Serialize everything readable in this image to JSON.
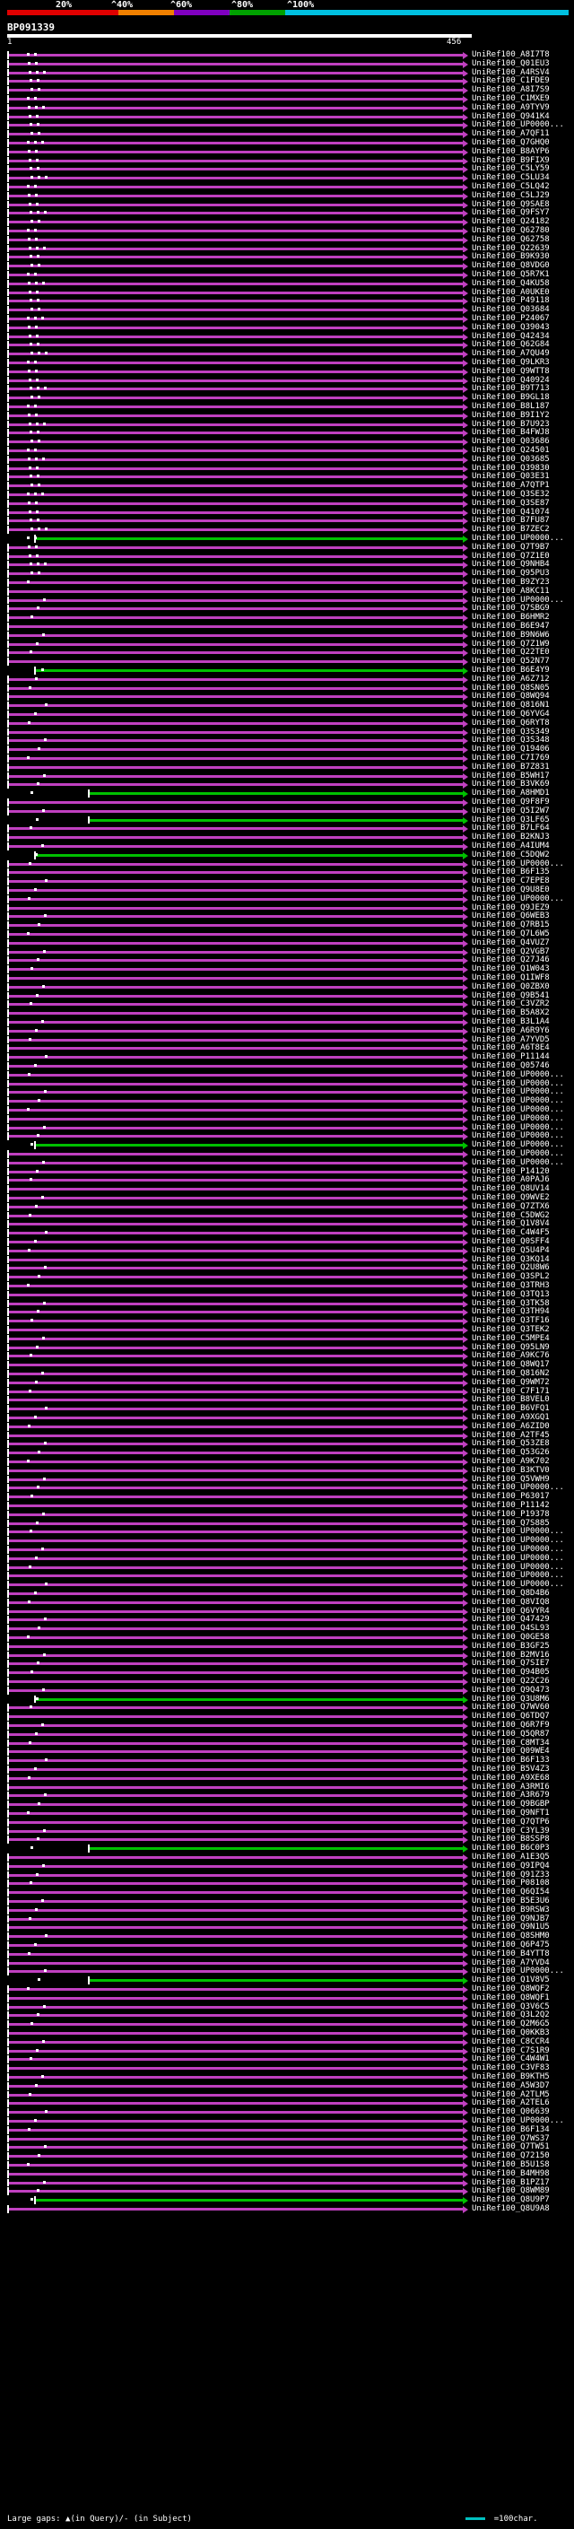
{
  "scale": {
    "labels": [
      "20%",
      "^40%",
      "^60%",
      "^80%",
      "^100%"
    ],
    "colors": [
      "#e00000",
      "#f08000",
      "#8000c0",
      "#00a000",
      "#00c0e0"
    ]
  },
  "query": {
    "id": "BP091339",
    "start": "1",
    "end": "456"
  },
  "colors": {
    "hit_line": "#c040c0",
    "green": "#00c000",
    "gap_marker": "#ff80ff",
    "legend_line": "#00c0c0"
  },
  "hits": [
    "UniRef100_A8I7T8",
    "UniRef100_Q01EU3",
    "UniRef100_A4RSV4",
    "UniRef100_C1FDE9",
    "UniRef100_A8I7S9",
    "UniRef100_C1MXE9",
    "UniRef100_A9TYV9",
    "UniRef100_Q941K4",
    "UniRef100_UP0000...",
    "UniRef100_A7QF11",
    "UniRef100_Q7GHQ0",
    "UniRef100_B8AYP6",
    "UniRef100_B9FIX9",
    "UniRef100_C5LY59",
    "UniRef100_C5LU34",
    "UniRef100_C5LQ42",
    "UniRef100_C5LJ29",
    "UniRef100_Q9SAE8",
    "UniRef100_Q9FSY7",
    "UniRef100_Q24182",
    "UniRef100_Q62780",
    "UniRef100_Q62758",
    "UniRef100_Q22639",
    "UniRef100_B9K930",
    "UniRef100_Q8VDG0",
    "UniRef100_Q5R7K1",
    "UniRef100_Q4KU58",
    "UniRef100_A0UKE0",
    "UniRef100_P49118",
    "UniRef100_Q03684",
    "UniRef100_P24067",
    "UniRef100_Q39043",
    "UniRef100_Q42434",
    "UniRef100_Q62G84",
    "UniRef100_A7QU49",
    "UniRef100_Q9LKR3",
    "UniRef100_Q9WTT8",
    "UniRef100_Q40924",
    "UniRef100_B9T713",
    "UniRef100_B9GL18",
    "UniRef100_B8L187",
    "UniRef100_B9I1Y2",
    "UniRef100_B7U923",
    "UniRef100_B4FWJ8",
    "UniRef100_Q03686",
    "UniRef100_Q24501",
    "UniRef100_Q03685",
    "UniRef100_Q39830",
    "UniRef100_Q03E31",
    "UniRef100_A7QTP1",
    "UniRef100_Q3SE32",
    "UniRef100_Q3SE87",
    "UniRef100_Q41074",
    "UniRef100_B7FU87",
    "UniRef100_B7ZEC2",
    "UniRef100_UP0000...",
    "UniRef100_Q7T9B7",
    "UniRef100_Q7Z1E0",
    "UniRef100_Q9NHB4",
    "UniRef100_Q95PU3",
    "UniRef100_B9ZY23",
    "UniRef100_A8KC11",
    "UniRef100_UP0000...",
    "UniRef100_Q7SBG9",
    "UniRef100_B6HMR2",
    "UniRef100_B6E947",
    "UniRef100_B9N6W6",
    "UniRef100_Q7Z1W9",
    "UniRef100_Q22TE0",
    "UniRef100_Q52N77",
    "UniRef100_B6E4Y9",
    "UniRef100_A6Z712",
    "UniRef100_Q8SN05",
    "UniRef100_Q8WQ94",
    "UniRef100_Q816N1",
    "UniRef100_Q6YVG4",
    "UniRef100_Q6RYT8",
    "UniRef100_Q3S349",
    "UniRef100_Q3S348",
    "UniRef100_Q19406",
    "UniRef100_C7I769",
    "UniRef100_B7Z831",
    "UniRef100_B5WH17",
    "UniRef100_B3VK69",
    "UniRef100_A8HMD1",
    "UniRef100_Q9F8F9",
    "UniRef100_Q5I2W7",
    "UniRef100_Q3LF65",
    "UniRef100_B7LF64",
    "UniRef100_B2KNJ3",
    "UniRef100_A4IUM4",
    "UniRef100_C5DQW2",
    "UniRef100_UP0000...",
    "UniRef100_B6F135",
    "UniRef100_C7EPE8",
    "UniRef100_Q9U8E0",
    "UniRef100_UP0000...",
    "UniRef100_Q9JEZ9",
    "UniRef100_Q6WEB3",
    "UniRef100_Q7RB15",
    "UniRef100_Q7L6W5",
    "UniRef100_Q4VUZ7",
    "UniRef100_Q2VGB7",
    "UniRef100_Q27J46",
    "UniRef100_Q1W043",
    "UniRef100_Q1IWF8",
    "UniRef100_Q0ZBX0",
    "UniRef100_Q9B541",
    "UniRef100_C3VZR2",
    "UniRef100_B5A8X2",
    "UniRef100_B3L1A4",
    "UniRef100_A6R9Y6",
    "UniRef100_A7YVD5",
    "UniRef100_A6T8E4",
    "UniRef100_P11144",
    "UniRef100_Q05746",
    "UniRef100_UP0000...",
    "UniRef100_UP0000...",
    "UniRef100_UP0000...",
    "UniRef100_UP0000...",
    "UniRef100_UP0000...",
    "UniRef100_UP0000...",
    "UniRef100_UP0000...",
    "UniRef100_UP0000...",
    "UniRef100_UP0000...",
    "UniRef100_UP0000...",
    "UniRef100_UP0000...",
    "UniRef100_P14120",
    "UniRef100_A0PAJ6",
    "UniRef100_Q8UV14",
    "UniRef100_Q9WVE2",
    "UniRef100_Q7ZTX6",
    "UniRef100_C5DWG2",
    "UniRef100_Q1V8V4",
    "UniRef100_C4W4F5",
    "UniRef100_Q0SFF4",
    "UniRef100_Q5U4P4",
    "UniRef100_Q3KQ14",
    "UniRef100_Q2U8W6",
    "UniRef100_Q3SPL2",
    "UniRef100_Q3TRH3",
    "UniRef100_Q3TQ13",
    "UniRef100_Q3TK58",
    "UniRef100_Q3TH94",
    "UniRef100_Q3TF16",
    "UniRef100_Q3TEK2",
    "UniRef100_C5MPE4",
    "UniRef100_Q95LN9",
    "UniRef100_A9KC76",
    "UniRef100_Q8WQ17",
    "UniRef100_Q816N2",
    "UniRef100_Q9WM72",
    "UniRef100_C7F171",
    "UniRef100_B8VEL0",
    "UniRef100_B6VFQ1",
    "UniRef100_A9XGQ1",
    "UniRef100_A6ZID0",
    "UniRef100_A2TF45",
    "UniRef100_Q53ZE8",
    "UniRef100_Q53G26",
    "UniRef100_A9K702",
    "UniRef100_B3KTV0",
    "UniRef100_Q5VWH9",
    "UniRef100_UP0000...",
    "UniRef100_P63017",
    "UniRef100_P11142",
    "UniRef100_P19378",
    "UniRef100_Q7S885",
    "UniRef100_UP0000...",
    "UniRef100_UP0000...",
    "UniRef100_UP0000...",
    "UniRef100_UP0000...",
    "UniRef100_UP0000...",
    "UniRef100_UP0000...",
    "UniRef100_UP0000...",
    "UniRef100_Q8D4B6",
    "UniRef100_Q8VIQ8",
    "UniRef100_Q6VYR4",
    "UniRef100_Q47429",
    "UniRef100_Q4SL93",
    "UniRef100_Q0GE58",
    "UniRef100_B3GF25",
    "UniRef100_B2MV16",
    "UniRef100_Q7SIE7",
    "UniRef100_Q94B05",
    "UniRef100_Q22C26",
    "UniRef100_Q9Q473",
    "UniRef100_Q3U8M6",
    "UniRef100_Q7WV60",
    "UniRef100_Q6TDQ7",
    "UniRef100_Q6R7F9",
    "UniRef100_Q5QR87",
    "UniRef100_C8MT34",
    "UniRef100_Q09WE4",
    "UniRef100_B6F133",
    "UniRef100_B5V4Z3",
    "UniRef100_A9XE68",
    "UniRef100_A3RMI6",
    "UniRef100_A3R679",
    "UniRef100_Q9BGBP",
    "UniRef100_Q9NFT1",
    "UniRef100_Q7QTP6",
    "UniRef100_C3YL39",
    "UniRef100_B8SSP8",
    "UniRef100_B6C0P3",
    "UniRef100_A1E3Q5",
    "UniRef100_Q9IPQ4",
    "UniRef100_Q91Z33",
    "UniRef100_P08108",
    "UniRef100_Q6QI54",
    "UniRef100_B5E3U6",
    "UniRef100_B9RSW3",
    "UniRef100_Q9NJB7",
    "UniRef100_Q9N1U5",
    "UniRef100_Q8SHM0",
    "UniRef100_Q6P475",
    "UniRef100_B4YTT8",
    "UniRef100_A7YVD4",
    "UniRef100_UP0000...",
    "UniRef100_Q1V8V5",
    "UniRef100_Q8WQF2",
    "UniRef100_Q8WQF1",
    "UniRef100_Q3V6C5",
    "UniRef100_Q3L2Q2",
    "UniRef100_Q2M6G5",
    "UniRef100_Q0KKB3",
    "UniRef100_C8CCR4",
    "UniRef100_C7S1R9",
    "UniRef100_C4W4W1",
    "UniRef100_C3VF83",
    "UniRef100_B9KTH5",
    "UniRef100_A5W3D7",
    "UniRef100_A2TLM5",
    "UniRef100_A2TEL6",
    "UniRef100_Q06639",
    "UniRef100_UP0000...",
    "UniRef100_B6F134",
    "UniRef100_Q7WS37",
    "UniRef100_Q7TW51",
    "UniRef100_Q72150",
    "UniRef100_B5U1S8",
    "UniRef100_B4MH98",
    "UniRef100_B1PZ17",
    "UniRef100_Q8WM89",
    "UniRef100_Q8U9P7",
    "UniRef100_Q8U9A8"
  ],
  "green_hits": [
    55,
    70,
    84,
    87,
    91,
    124,
    187,
    204,
    219,
    244,
    253,
    254
  ],
  "legend": {
    "text": "Large gaps: ▲(in Query)/- (in Subject)",
    "scale_text": "=100char."
  }
}
